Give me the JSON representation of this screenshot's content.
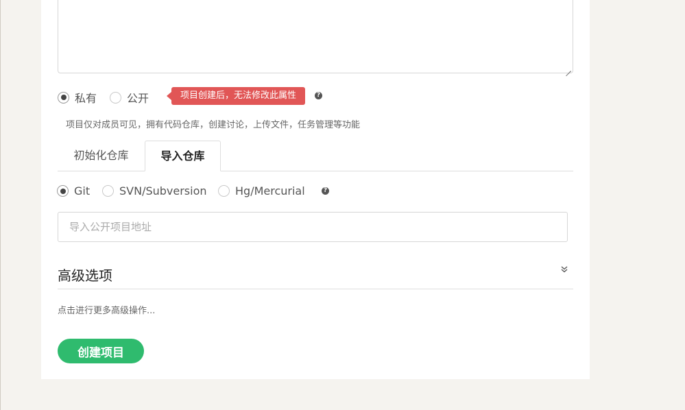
{
  "visibility": {
    "options": [
      {
        "label": "私有",
        "selected": true
      },
      {
        "label": "公开",
        "selected": false
      }
    ],
    "badge": "项目创建后，无法修改此属性",
    "help_icon": "question-icon",
    "description": "项目仅对成员可见，拥有代码仓库，创建讨论，上传文件，任务管理等功能"
  },
  "tabs": [
    {
      "label": "初始化仓库",
      "active": false
    },
    {
      "label": "导入仓库",
      "active": true
    }
  ],
  "vcs": {
    "options": [
      {
        "label": "Git",
        "selected": true
      },
      {
        "label": "SVN/Subversion",
        "selected": false
      },
      {
        "label": "Hg/Mercurial",
        "selected": false
      }
    ],
    "help_icon": "question-icon"
  },
  "import_url": {
    "value": "",
    "placeholder": "导入公开项目地址"
  },
  "advanced": {
    "title": "高级选项",
    "hint": "点击进行更多高级操作...",
    "chevron_icon": "chevron-double-down-icon"
  },
  "create_button": "创建项目",
  "colors": {
    "accent_green": "#2fbb6e",
    "badge_red": "#e15656",
    "page_bg": "#f5f3ef"
  }
}
